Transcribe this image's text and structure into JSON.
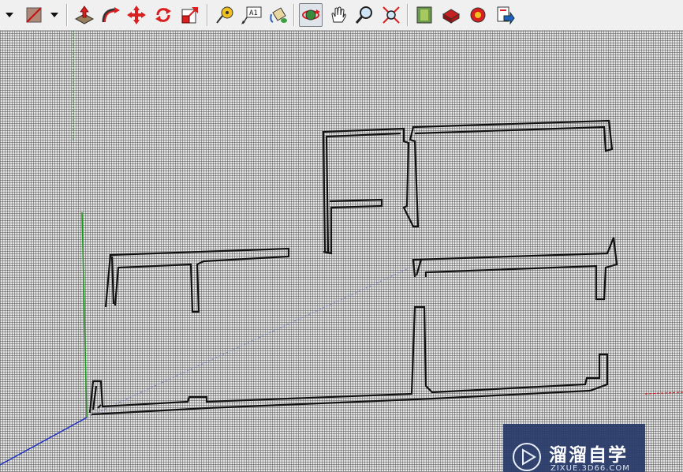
{
  "toolbar": {
    "buttons": [
      {
        "name": "select-dropdown-arrow"
      },
      {
        "name": "eraser-tool"
      },
      {
        "name": "push-pull-tool"
      },
      {
        "name": "follow-me-tool"
      },
      {
        "name": "move-tool"
      },
      {
        "name": "rotate-tool"
      },
      {
        "name": "scale-tool"
      },
      {
        "name": "tape-measure-tool"
      },
      {
        "name": "text-tool"
      },
      {
        "name": "paint-bucket-tool"
      },
      {
        "name": "orbit-tool",
        "active": true
      },
      {
        "name": "pan-tool"
      },
      {
        "name": "zoom-tool"
      },
      {
        "name": "zoom-extents-tool"
      },
      {
        "name": "get-models-tool"
      },
      {
        "name": "share-model-tool"
      },
      {
        "name": "share-component-tool"
      },
      {
        "name": "send-to-layout-tool"
      }
    ],
    "text_tool_label": "A1"
  },
  "watermark": {
    "title": "溜溜自学",
    "url": "ZIXUE.3D66.COM"
  },
  "colors": {
    "toolbar_bg": "#f0f0f0",
    "viewport_bg": "#e6e6e6",
    "axis_green": "#1a9a1a",
    "axis_red": "#d02020",
    "axis_blue": "#2030c0",
    "watermark_bg": "#283a69"
  }
}
